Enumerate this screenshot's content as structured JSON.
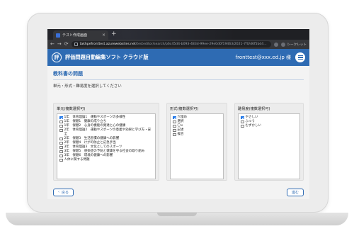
{
  "browser": {
    "tab_title": "テスト作成画面",
    "tab_close": "×",
    "new_tab": "+",
    "nav": {
      "back": "←",
      "forward": "→",
      "reload": "⟳"
    },
    "url_host": "takhpefronttest.azurewebsites.net",
    "url_path": "/testeditor/search/p6c45d4-b093-483d-99ee-29e0d0f19463/2021-7f0/d6f5bd4...",
    "profile_label": "シークレット"
  },
  "header": {
    "logo_glyph": "評",
    "app_title": "評価問題自動編集ソフト クラウド版",
    "user": "fronttest@xxx.ed.jp 様"
  },
  "page": {
    "title": "教科書の問題",
    "subtitle": "単元・形式・難易度を選択してください"
  },
  "units": {
    "label": "単元(複数選択可)",
    "items": [
      {
        "text": "1年　体育理論1　運動やスポーツの多様性",
        "checked": true
      },
      {
        "text": "1年　保健1　健康の成り立ち",
        "checked": false
      },
      {
        "text": "1年　保健2　心身の機能の発達と心の健康",
        "checked": false
      },
      {
        "text": "2年　体育理論2　運動やスポーツの意義や効果と学び方・安全",
        "checked": false
      },
      {
        "text": "2年　保健3　生活習慣の健康への影響",
        "checked": false
      },
      {
        "text": "2年　保健4　けがの防止と応急手当",
        "checked": false
      },
      {
        "text": "3年　体育理論3　文化としてのスポーツ",
        "checked": false
      },
      {
        "text": "3年　保健5　感染症の予防と健康を守る社会の取り組み",
        "checked": false
      },
      {
        "text": "3年　保健6　環境の健康への影響",
        "checked": false
      },
      {
        "text": "人体に関する問題",
        "checked": false
      }
    ]
  },
  "formats": {
    "label": "形式(複数選択可)",
    "items": [
      {
        "text": "穴埋め",
        "checked": true
      },
      {
        "text": "選択",
        "checked": false
      },
      {
        "text": "〇×",
        "checked": false
      },
      {
        "text": "記述",
        "checked": false
      },
      {
        "text": "複合",
        "checked": false
      }
    ]
  },
  "difficulty": {
    "label": "難易度(複数選択可)",
    "items": [
      {
        "text": "やさしい",
        "checked": true
      },
      {
        "text": "ふつう",
        "checked": false
      },
      {
        "text": "むずかしい",
        "checked": false
      }
    ]
  },
  "footer": {
    "back_label": "戻る",
    "back_icon": "‹",
    "next_label": "進む"
  },
  "colors": {
    "brand": "#2e6bb3",
    "checkbox_on": "#1a73e8"
  }
}
